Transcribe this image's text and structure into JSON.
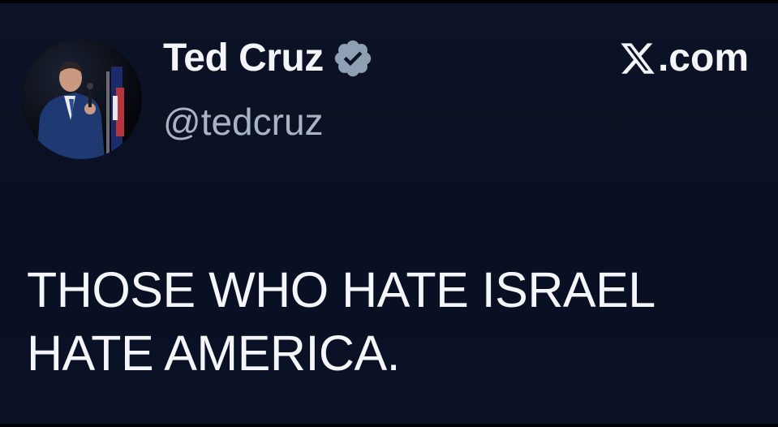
{
  "profile": {
    "display_name": "Ted Cruz",
    "handle": "@tedcruz",
    "verified_icon": "verified-badge-icon",
    "avatar_icon": "profile-photo"
  },
  "brand": {
    "logo_icon": "x-logo-icon",
    "text": ".com"
  },
  "tweet": {
    "lines": [
      "THOSE WHO HATE ISRAEL",
      "HATE AMERICA."
    ]
  },
  "colors": {
    "background": "#0b1023",
    "text_primary": "#f3f5f9",
    "text_secondary": "#a8b3c4",
    "verified_badge": "#8fa0b4"
  }
}
